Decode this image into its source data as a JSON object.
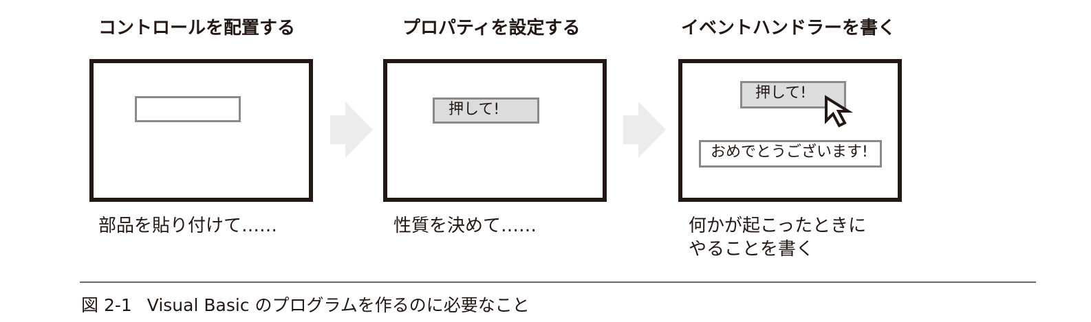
{
  "steps": [
    {
      "title": "コントロールを配置する",
      "caption": "部品を貼り付けて……"
    },
    {
      "title": "プロパティを設定する",
      "control_label": "押して!",
      "caption": "性質を決めて……"
    },
    {
      "title": "イベントハンドラーを書く",
      "control_label": "押して!",
      "output_label": "おめでとうございます!",
      "caption_line1": "何かが起こったときに",
      "caption_line2": "やることを書く"
    }
  ],
  "figure": {
    "number": "図 2-1",
    "caption": "Visual Basic のプログラムを作るのに必要なこと"
  },
  "colors": {
    "ink": "#231815",
    "control_border": "#8a8a8a",
    "control_fill": "#dcdcdc",
    "arrow": "#ececec"
  },
  "icons": [
    "right-arrow-icon",
    "mouse-pointer-icon"
  ]
}
